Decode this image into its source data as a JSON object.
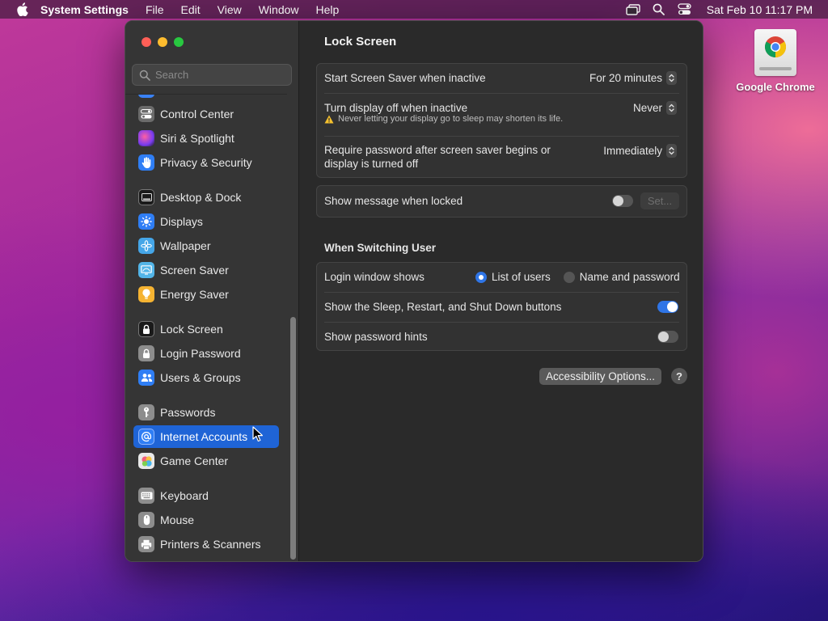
{
  "menubar": {
    "app_name": "System Settings",
    "menus": [
      "File",
      "Edit",
      "View",
      "Window",
      "Help"
    ],
    "status_icons": [
      "screen-mirroring-icon",
      "spotlight-search-icon",
      "control-center-icon"
    ],
    "clock": "Sat Feb 10  11:17 PM"
  },
  "desktop": {
    "icon_label": "Google Chrome"
  },
  "window": {
    "search": {
      "placeholder": "Search"
    },
    "sidebar": {
      "items": [
        {
          "label": "Control Center",
          "icon": "control-center-icon",
          "color": "#6b6b6b"
        },
        {
          "label": "Siri & Spotlight",
          "icon": "siri-icon",
          "color": "#b2389c"
        },
        {
          "label": "Privacy & Security",
          "icon": "hand-icon",
          "color": "#2f7ef5"
        },
        {
          "label": "Desktop & Dock",
          "icon": "dock-icon",
          "color": "#1a1a1a"
        },
        {
          "label": "Displays",
          "icon": "sun-icon",
          "color": "#2f7ef5"
        },
        {
          "label": "Wallpaper",
          "icon": "flower-icon",
          "color": "#45a6e8"
        },
        {
          "label": "Screen Saver",
          "icon": "screen-saver-icon",
          "color": "#53b5e8"
        },
        {
          "label": "Energy Saver",
          "icon": "lightbulb-icon",
          "color": "#f5b332"
        },
        {
          "label": "Lock Screen",
          "icon": "lock-icon",
          "color": "#1a1a1a"
        },
        {
          "label": "Login Password",
          "icon": "lock-icon",
          "color": "#8d8d8d"
        },
        {
          "label": "Users & Groups",
          "icon": "users-icon",
          "color": "#2f7ef5"
        },
        {
          "label": "Passwords",
          "icon": "key-icon",
          "color": "#8d8d8d"
        },
        {
          "label": "Internet Accounts",
          "icon": "at-icon",
          "color": "#2f7ef5",
          "selected": true
        },
        {
          "label": "Game Center",
          "icon": "game-center-icon",
          "color": "#e9e9e9"
        },
        {
          "label": "Keyboard",
          "icon": "keyboard-icon",
          "color": "#8d8d8d"
        },
        {
          "label": "Mouse",
          "icon": "mouse-icon",
          "color": "#8d8d8d"
        },
        {
          "label": "Printers & Scanners",
          "icon": "printer-icon",
          "color": "#8d8d8d"
        }
      ]
    },
    "main": {
      "title": "Lock Screen",
      "screen_saver": {
        "label": "Start Screen Saver when inactive",
        "value": "For 20 minutes"
      },
      "display_off": {
        "label": "Turn display off when inactive",
        "value": "Never",
        "warning": "Never letting your display go to sleep may shorten its life."
      },
      "require_password": {
        "label_line1": "Require password after screen saver begins or",
        "label_line2": "display is turned off",
        "value": "Immediately"
      },
      "show_message": {
        "label": "Show message when locked",
        "enabled": false,
        "button": "Set..."
      },
      "switching_section": "When Switching User",
      "login_window": {
        "label": "Login window shows",
        "options": [
          "List of users",
          "Name and password"
        ],
        "selected": "List of users"
      },
      "shutdown_buttons": {
        "label": "Show the Sleep, Restart, and Shut Down buttons",
        "enabled": true
      },
      "password_hints": {
        "label": "Show password hints",
        "enabled": false
      },
      "accessibility_button": "Accessibility Options...",
      "help_button": "?"
    }
  },
  "colors": {
    "accent": "#2f75e6",
    "selection": "#1f64d6",
    "window_bg": "#2a2a2a",
    "sidebar_bg": "#353535"
  }
}
